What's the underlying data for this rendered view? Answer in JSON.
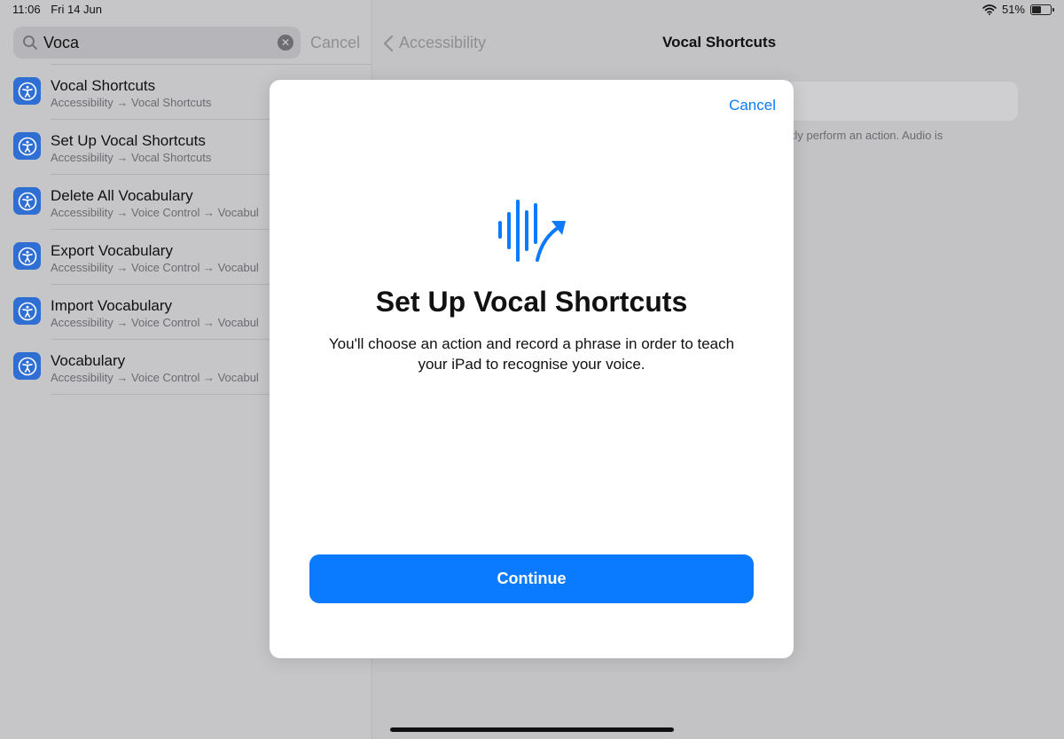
{
  "status": {
    "time": "11:06",
    "date": "Fri 14 Jun",
    "battery": "51%",
    "battery_level": 0.51
  },
  "search": {
    "value": "Voca",
    "placeholder": "Search",
    "cancel_label": "Cancel"
  },
  "results": [
    {
      "title": "Vocal Shortcuts",
      "path": "Accessibility → Vocal Shortcuts"
    },
    {
      "title": "Set Up Vocal Shortcuts",
      "path": "Accessibility → Vocal Shortcuts"
    },
    {
      "title": "Delete All Vocabulary",
      "path": "Accessibility → Voice Control → Vocabul"
    },
    {
      "title": "Export Vocabulary",
      "path": "Accessibility → Voice Control → Vocabul"
    },
    {
      "title": "Import Vocabulary",
      "path": "Accessibility → Voice Control → Vocabul"
    },
    {
      "title": "Vocabulary",
      "path": "Accessibility → Voice Control → Vocabul"
    }
  ],
  "detail": {
    "back_label": "Accessibility",
    "title": "Vocal Shortcuts",
    "footnote": "kly perform an action. Audio is"
  },
  "modal": {
    "cancel_label": "Cancel",
    "glyph": "waveform-arrow-icon",
    "title": "Set Up Vocal Shortcuts",
    "body": "You'll choose an action and record a phrase in order to teach your iPad to recognise your voice.",
    "continue_label": "Continue"
  },
  "colors": {
    "accent": "#0a7aff",
    "app_icon": "#2f6fd3"
  }
}
